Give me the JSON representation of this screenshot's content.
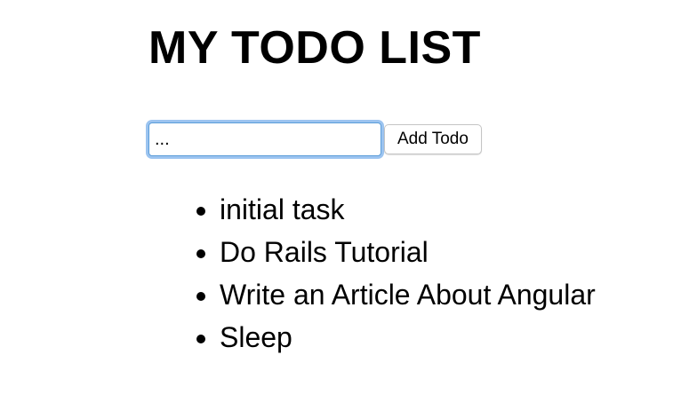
{
  "page": {
    "title": "MY TODO LIST"
  },
  "form": {
    "input_value": "...",
    "add_label": "Add Todo"
  },
  "todos": [
    "initial task",
    "Do Rails Tutorial",
    "Write an Article About Angular",
    "Sleep"
  ]
}
